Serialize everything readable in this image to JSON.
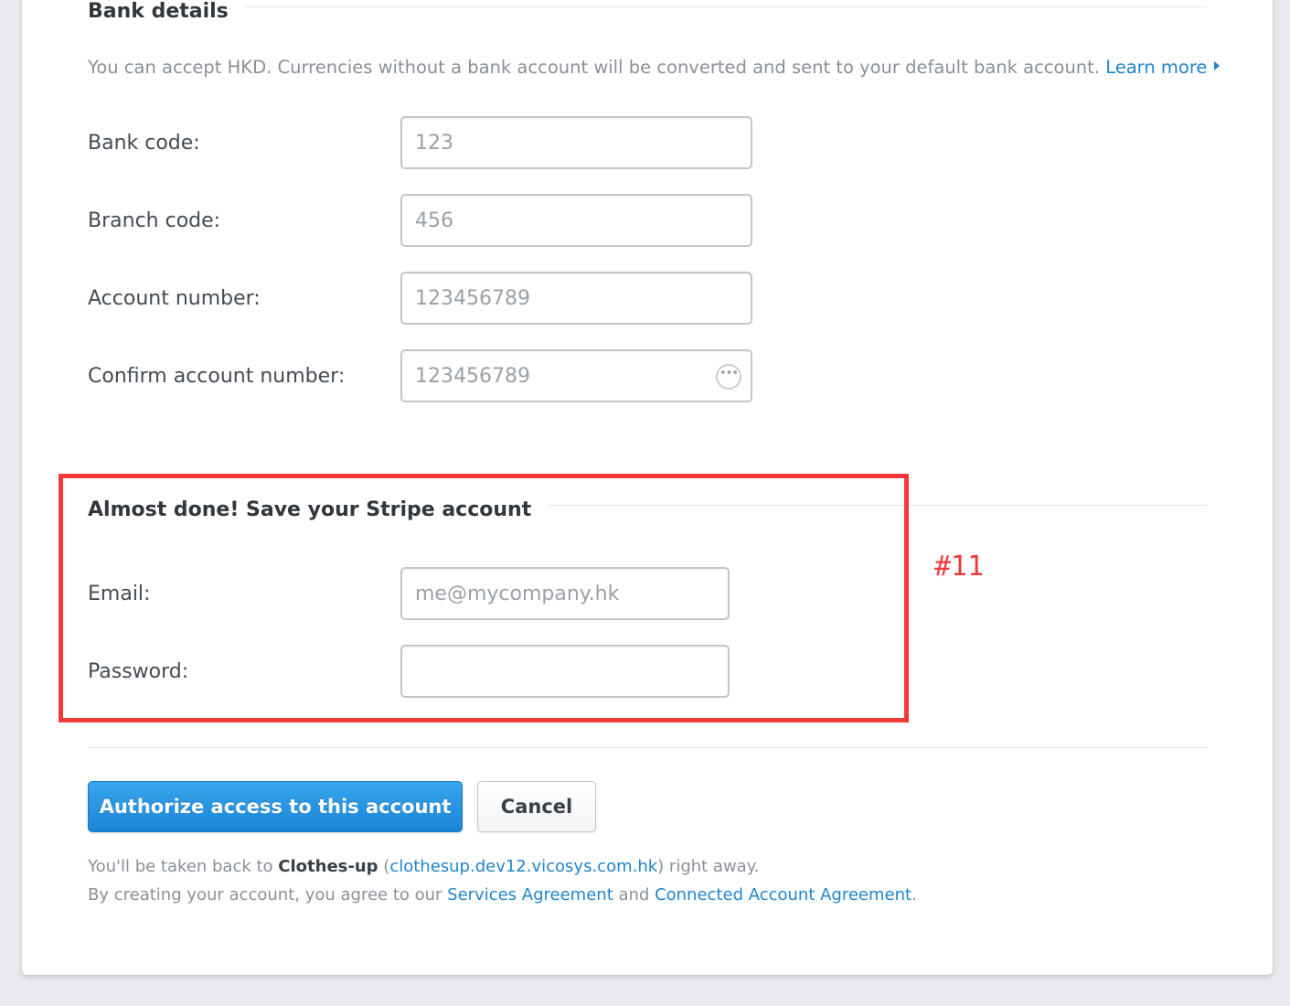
{
  "bank_details": {
    "title": "Bank details",
    "description": "You can accept HKD. Currencies without a bank account will be converted and sent to your default bank account.",
    "learn_more": "Learn more",
    "fields": {
      "bank_code": {
        "label": "Bank code:",
        "placeholder": "123"
      },
      "branch_code": {
        "label": "Branch code:",
        "placeholder": "456"
      },
      "account_number": {
        "label": "Account number:",
        "placeholder": "123456789"
      },
      "confirm_account_number": {
        "label": "Confirm account number:",
        "placeholder": "123456789"
      }
    }
  },
  "save_account": {
    "title": "Almost done! Save your Stripe account",
    "fields": {
      "email": {
        "label": "Email:",
        "placeholder": "me@mycompany.hk"
      },
      "password": {
        "label": "Password:",
        "placeholder": ""
      }
    }
  },
  "annotation": {
    "label": "#11",
    "color": "#f03a3a"
  },
  "actions": {
    "authorize_label": "Authorize access to this account",
    "cancel_label": "Cancel"
  },
  "footer": {
    "line1_prefix": "You'll be taken back to ",
    "app_name": "Clothes-up",
    "paren_open": " (",
    "app_url": "clothesup.dev12.vicosys.com.hk",
    "line1_suffix": ") right away.",
    "line2_prefix": "By creating your account, you agree to our ",
    "services_agreement": "Services Agreement",
    "and": " and ",
    "connected_agreement": "Connected Account Agreement",
    "period": "."
  },
  "colors": {
    "link": "#1f85cc",
    "primary_button": "#1c84d4",
    "highlight": "#f03a3a",
    "background": "#e8eaee"
  }
}
